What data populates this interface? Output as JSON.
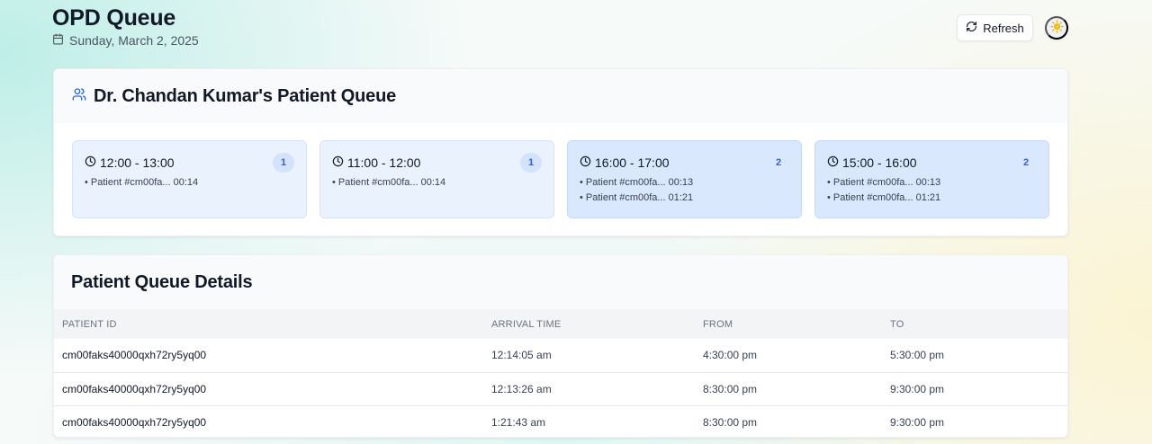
{
  "header": {
    "title": "OPD Queue",
    "date": "Sunday, March 2, 2025",
    "refresh_label": "Refresh",
    "calendar_icon": "calendar-icon",
    "theme_icon": "sun-icon"
  },
  "queue_card": {
    "title": "Dr. Chandan Kumar's Patient Queue",
    "icon": "users-icon",
    "slots": [
      {
        "time": "12:00 - 13:00",
        "count": "1",
        "patients": [
          "Patient #cm00fa... 00:14"
        ]
      },
      {
        "time": "11:00 - 12:00",
        "count": "1",
        "patients": [
          "Patient #cm00fa... 00:14"
        ]
      },
      {
        "time": "16:00 - 17:00",
        "count": "2",
        "patients": [
          "Patient #cm00fa... 00:13",
          "Patient #cm00fa... 01:21"
        ]
      },
      {
        "time": "15:00 - 16:00",
        "count": "2",
        "patients": [
          "Patient #cm00fa... 00:13",
          "Patient #cm00fa... 01:21"
        ]
      }
    ]
  },
  "details_card": {
    "title": "Patient Queue Details",
    "columns": [
      "PATIENT ID",
      "ARRIVAL TIME",
      "FROM",
      "TO"
    ],
    "rows": [
      [
        "cm00faks40000qxh72ry5yq00",
        "12:14:05 am",
        "4:30:00 pm",
        "5:30:00 pm"
      ],
      [
        "cm00faks40000qxh72ry5yq00",
        "12:13:26 am",
        "8:30:00 pm",
        "9:30:00 pm"
      ],
      [
        "cm00faks40000qxh72ry5yq00",
        "1:21:43 am",
        "8:30:00 pm",
        "9:30:00 pm"
      ]
    ]
  },
  "colors": {
    "accent": "#2563eb",
    "slot_bg": "#eaf2fe",
    "slot_busy_bg": "#d9e8fd",
    "theme_sun": "#eab308"
  }
}
